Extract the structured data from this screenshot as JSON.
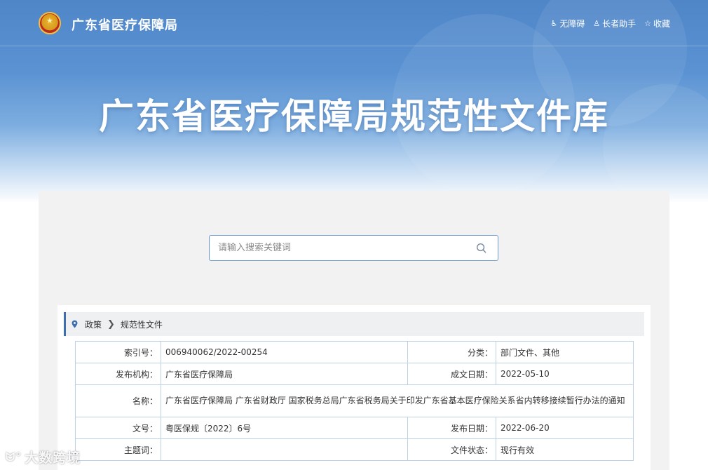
{
  "header": {
    "site_name": "广东省医疗保障局",
    "links": [
      {
        "icon": "accessibility-icon",
        "label": "无障碍"
      },
      {
        "icon": "elder-assist-icon",
        "label": "长者助手"
      },
      {
        "icon": "star-icon",
        "label": "收藏"
      }
    ]
  },
  "hero": {
    "title": "广东省医疗保障局规范性文件库"
  },
  "search": {
    "placeholder": "请输入搜索关键词"
  },
  "breadcrumb": {
    "items": [
      "政策",
      "规范性文件"
    ]
  },
  "meta": {
    "index_label": "索引号：",
    "index_value": "006940062/2022-00254",
    "category_label": "分类：",
    "category_value": "部门文件、其他",
    "publisher_label": "发布机构：",
    "publisher_value": "广东省医疗保障局",
    "created_label": "成文日期：",
    "created_value": "2022-05-10",
    "name_label": "名称：",
    "name_value": "广东省医疗保障局 广东省财政厅 国家税务总局广东省税务局关于印发广东省基本医疗保险关系省内转移接续暂行办法的通知",
    "docno_label": "文号：",
    "docno_value": "粤医保规〔2022〕6号",
    "published_label": "发布日期：",
    "published_value": "2022-06-20",
    "subject_label": "主题词：",
    "subject_value": "",
    "status_label": "文件状态：",
    "status_value": "现行有效"
  },
  "watermark": {
    "text": "大数跨境"
  },
  "colors": {
    "accent": "#3d6fb0",
    "border": "#bcd0e6",
    "banner": "#5a92d2"
  }
}
